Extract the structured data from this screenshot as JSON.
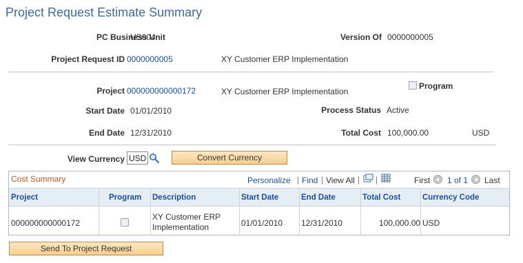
{
  "page": {
    "title": "Project Request Estimate Summary"
  },
  "header": {
    "pc_business_unit_label": "PC Business Unit",
    "pc_business_unit_value": "US004",
    "version_of_label": "Version Of",
    "version_of_value": "0000000005",
    "project_request_id_label": "Project Request ID",
    "project_request_id_value": "0000000005",
    "project_request_desc": "XY Customer ERP Implementation"
  },
  "project": {
    "project_label": "Project",
    "project_value": "000000000000172",
    "project_desc": "XY Customer ERP Implementation",
    "program_label": "Program",
    "program_checked": false,
    "start_date_label": "Start Date",
    "start_date_value": "01/01/2010",
    "process_status_label": "Process Status",
    "process_status_value": "Active",
    "end_date_label": "End Date",
    "end_date_value": "12/31/2010",
    "total_cost_label": "Total Cost",
    "total_cost_value": "100,000.00",
    "total_cost_currency": "USD"
  },
  "currency": {
    "view_currency_label": "View Currency",
    "view_currency_value": "USD",
    "convert_button": "Convert Currency"
  },
  "grid": {
    "title": "Cost Summary",
    "personalize": "Personalize",
    "find": "Find",
    "view_all": "View All",
    "first": "First",
    "range": "1 of 1",
    "last": "Last",
    "columns": [
      "Project",
      "Program",
      "Description",
      "Start Date",
      "End Date",
      "Total Cost",
      "Currency Code"
    ],
    "rows": [
      {
        "project": "000000000000172",
        "program": false,
        "description_line1": "XY Customer ERP",
        "description_line2": "Implementation",
        "start_date": "01/01/2010",
        "end_date": "12/31/2010",
        "total_cost": "100,000.00",
        "currency_code": "USD"
      }
    ]
  },
  "footer": {
    "send_button": "Send To Project Request"
  },
  "colors": {
    "link": "#1b4f9c",
    "title": "#3e6b9c",
    "grid_title": "#b35b1f",
    "button": "#f8cf8e"
  }
}
